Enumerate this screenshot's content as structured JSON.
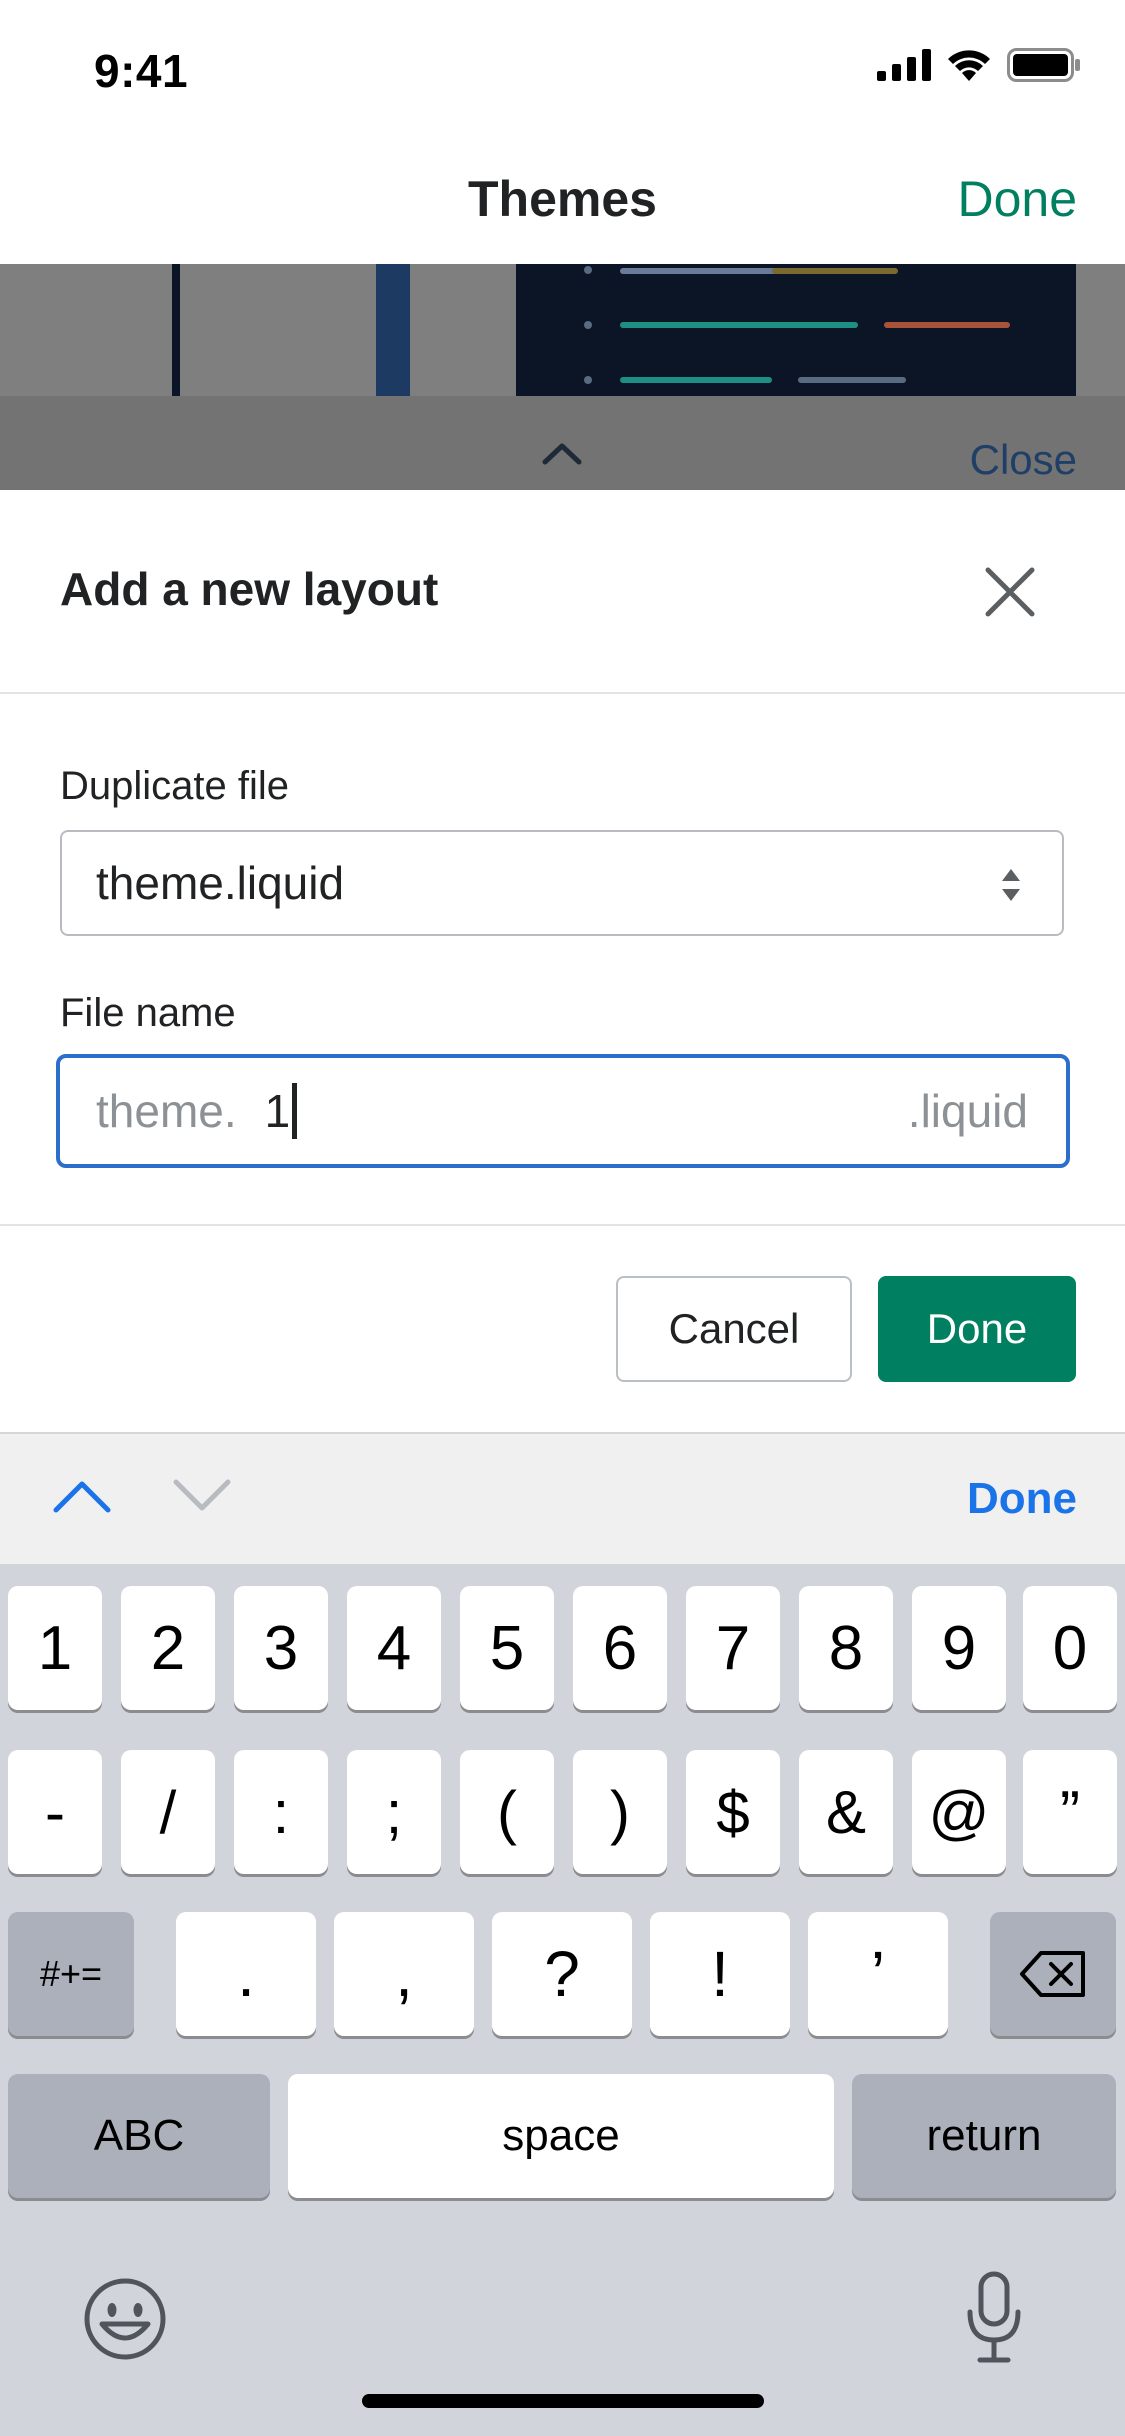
{
  "status_bar": {
    "time": "9:41"
  },
  "nav": {
    "title": "Themes",
    "done_label": "Done"
  },
  "preview": {
    "close_label": "Close"
  },
  "modal": {
    "title": "Add a new layout",
    "duplicate_label": "Duplicate file",
    "duplicate_value": "theme.liquid",
    "filename_label": "File name",
    "filename_prefix": "theme.",
    "filename_value": "1",
    "filename_suffix": ".liquid",
    "cancel_label": "Cancel",
    "done_label": "Done"
  },
  "accessory": {
    "done_label": "Done"
  },
  "keyboard": {
    "row1": [
      "1",
      "2",
      "3",
      "4",
      "5",
      "6",
      "7",
      "8",
      "9",
      "0"
    ],
    "row2": [
      "-",
      "/",
      ":",
      ";",
      "(",
      ")",
      "$",
      "&",
      "@",
      "”"
    ],
    "row3": [
      ".",
      ",",
      "?",
      "!",
      "’"
    ],
    "symbols_key": "#+=",
    "abc_key": "ABC",
    "space_key": "space",
    "return_key": "return"
  },
  "colors": {
    "brand_green": "#008060",
    "focus_blue": "#2c6ecb",
    "accessory_blue": "#1a73e8"
  }
}
